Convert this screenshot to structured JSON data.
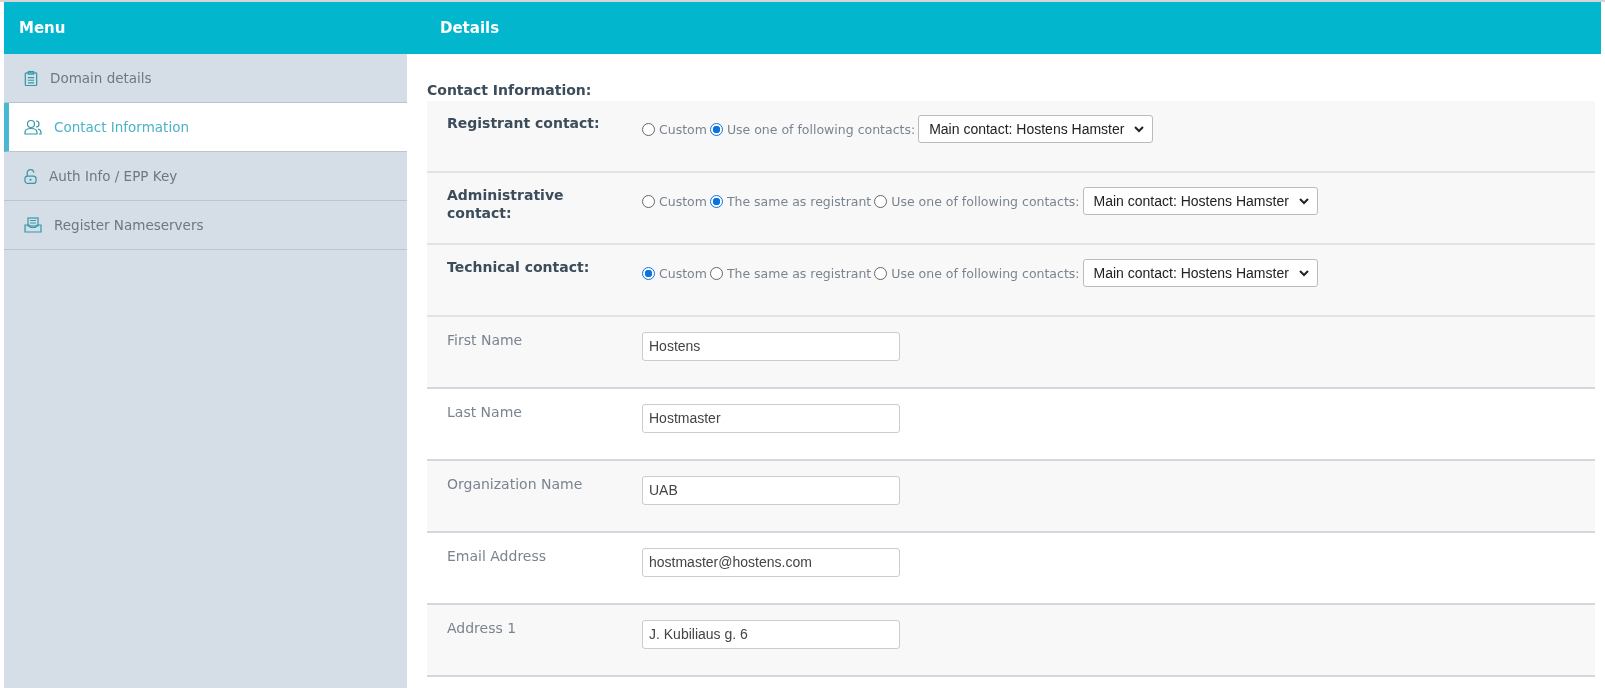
{
  "header": {
    "menu_title": "Menu",
    "details_title": "Details"
  },
  "sidebar": {
    "items": [
      {
        "label": "Domain details",
        "kind": "clipboard",
        "selected": false
      },
      {
        "label": "Contact Information",
        "kind": "people",
        "selected": true
      },
      {
        "label": "Auth Info / EPP Key",
        "kind": "lock",
        "selected": false
      },
      {
        "label": "Register Nameservers",
        "kind": "tray",
        "selected": false
      }
    ]
  },
  "section_title": "Contact Information:",
  "contacts": [
    {
      "label": "Registrant contact:",
      "options": [
        {
          "label": "Custom",
          "selected": false
        },
        {
          "label": "Use one of following contacts:",
          "selected": true
        }
      ],
      "select_value": "Main contact: Hostens Hamster"
    },
    {
      "label": "Administrative contact:",
      "options": [
        {
          "label": "Custom",
          "selected": false
        },
        {
          "label": "The same as registrant",
          "selected": true
        },
        {
          "label": "Use one of following contacts:",
          "selected": false
        }
      ],
      "select_value": "Main contact: Hostens Hamster"
    },
    {
      "label": "Technical contact:",
      "options": [
        {
          "label": "Custom",
          "selected": true
        },
        {
          "label": "The same as registrant",
          "selected": false
        },
        {
          "label": "Use one of following contacts:",
          "selected": false
        }
      ],
      "select_value": "Main contact: Hostens Hamster"
    }
  ],
  "fields": [
    {
      "label": "First Name",
      "value": "Hostens"
    },
    {
      "label": "Last Name",
      "value": "Hostmaster"
    },
    {
      "label": "Organization Name",
      "value": "UAB"
    },
    {
      "label": "Email Address",
      "value": "hostmaster@hostens.com"
    },
    {
      "label": "Address 1",
      "value": "J. Kubiliaus g. 6"
    }
  ]
}
